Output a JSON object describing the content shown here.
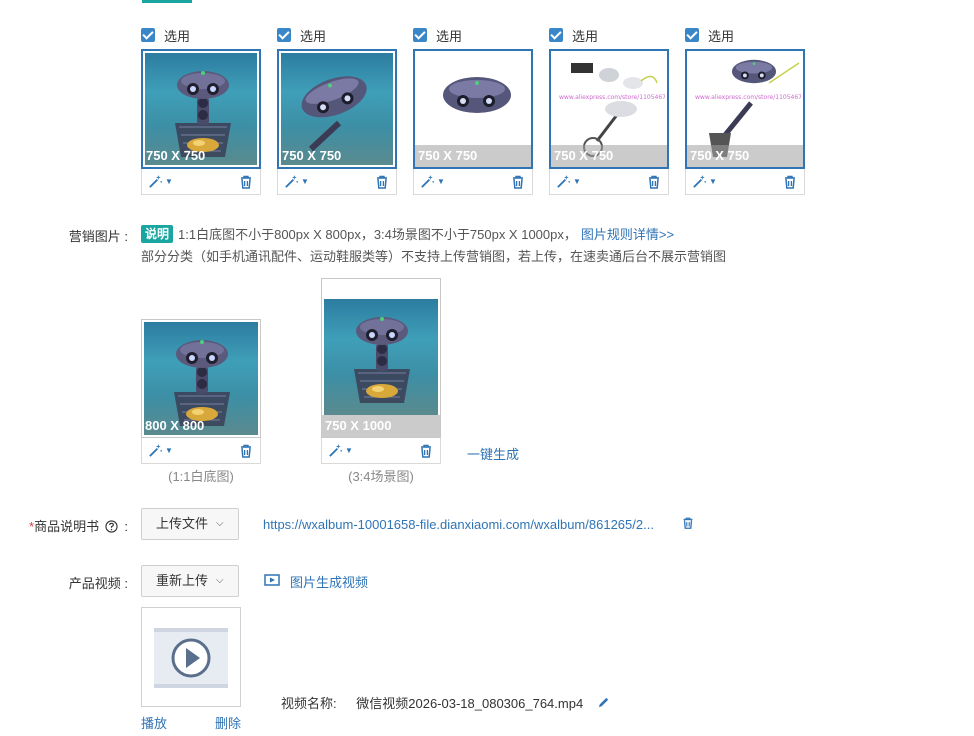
{
  "product_images": [
    {
      "select_label": "选用",
      "size": "750 X 750",
      "scene": "robot-sea"
    },
    {
      "select_label": "选用",
      "size": "750 X 750",
      "scene": "drone-sea"
    },
    {
      "select_label": "选用",
      "size": "750 X 750",
      "scene": "drone-white"
    },
    {
      "select_label": "选用",
      "size": "750 X 750",
      "scene": "accessories-white"
    },
    {
      "select_label": "选用",
      "size": "750 X 750",
      "scene": "arm-white"
    }
  ],
  "marketing": {
    "label": "营销图片 :",
    "badge": "说明",
    "rule_text": "1:1白底图不小于800px X 800px，3:4场景图不小于750px X 1000px，",
    "rule_link": "图片规则详情>>",
    "note": "部分分类（如手机通讯配件、运动鞋服类等）不支持上传营销图，若上传，在速卖通后台不展示营销图",
    "images": [
      {
        "size": "800 X 800",
        "caption": "(1:1白底图)"
      },
      {
        "size": "750 X 1000",
        "caption": "(3:4场景图)"
      }
    ],
    "generate_label": "一键生成"
  },
  "manual": {
    "required_mark": "*",
    "label": "商品说明书",
    "help_icon": "question-circle-icon",
    "colon": ":",
    "upload_button": "上传文件",
    "file_url": "https://wxalbum-10001658-file.dianxiaomi.com/wxalbum/861265/2..."
  },
  "video": {
    "label": "产品视频 :",
    "reupload_button": "重新上传",
    "generate_label": "图片生成视频",
    "play_label": "播放",
    "delete_label": "删除",
    "name_label": "视频名称:",
    "file_name": "微信视频2026-03-18_080306_764.mp4"
  },
  "colors": {
    "accent": "#2f74b5",
    "teal": "#1aa6a0",
    "required": "#e4393c"
  }
}
